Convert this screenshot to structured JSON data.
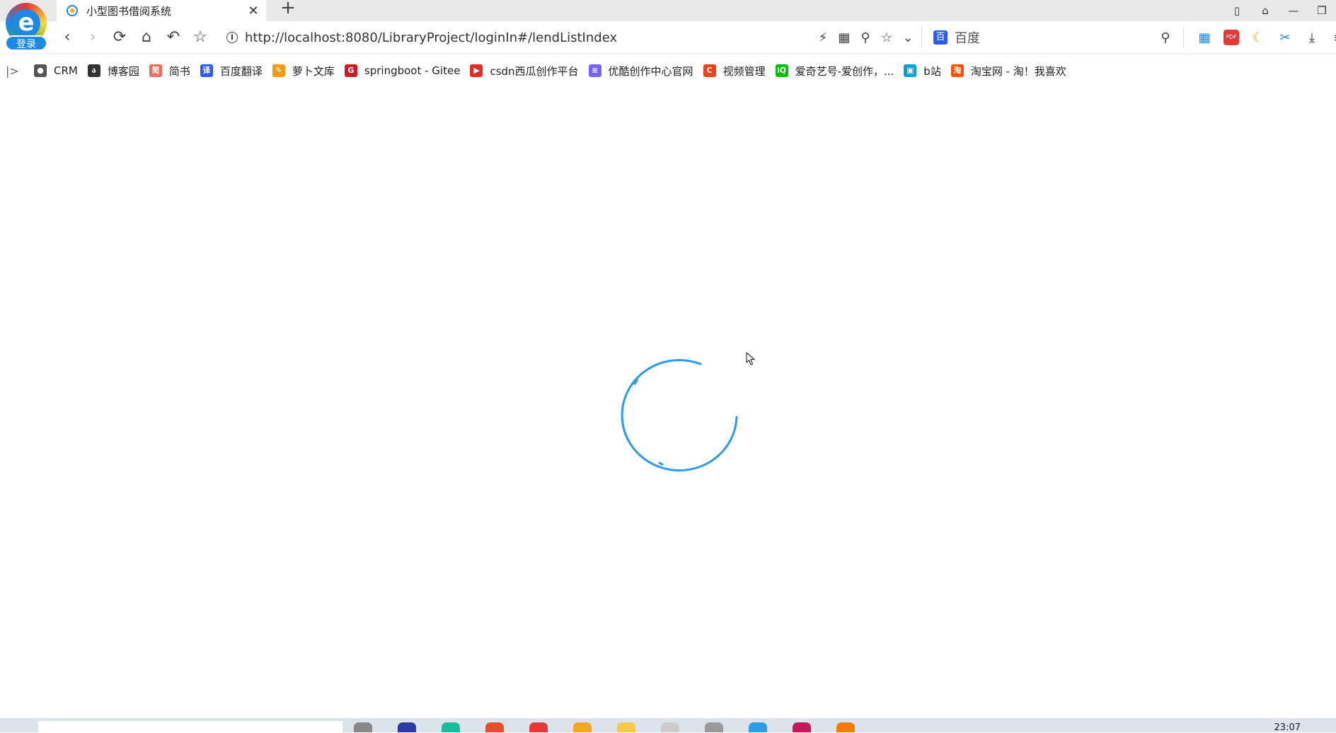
{
  "browser": {
    "logo_letter": "e",
    "login_label": "登录"
  },
  "tab": {
    "title": "小型图书借阅系统",
    "close_glyph": "✕"
  },
  "new_tab_glyph": "+",
  "window_controls": {
    "tile": "▯",
    "skin": "⌂",
    "minimize": "—",
    "restore": "❐"
  },
  "nav": {
    "back": "‹",
    "forward": "›",
    "reload": "⟳",
    "home": "⌂",
    "undo": "↶",
    "favorite": "☆"
  },
  "address": {
    "info_glyph": "i",
    "url": "http://localhost:8080/LibraryProject/loginIn#/lendListIndex"
  },
  "address_tools": [
    "⚡",
    "▦",
    "⚲",
    "☆",
    "⌄"
  ],
  "search": {
    "engine_glyph": "百",
    "placeholder": "百度",
    "search_glyph": "⚲"
  },
  "extensions": {
    "grid": "▦",
    "pdf": "PDF",
    "moon": "☾",
    "cut": "✂",
    "download": "⤓",
    "menu": "≡"
  },
  "bookmarks": {
    "toggle": "|>",
    "items": [
      {
        "label": "CRM",
        "icon": "globe-icon",
        "color": "#555555",
        "glyph": "●"
      },
      {
        "label": "博客园",
        "icon": "cnblogs-icon",
        "color": "#333333",
        "glyph": "ა"
      },
      {
        "label": "简书",
        "icon": "jianshu-icon",
        "color": "#ea6f5a",
        "glyph": "简"
      },
      {
        "label": "百度翻译",
        "icon": "translate-icon",
        "color": "#2b5de8",
        "glyph": "译"
      },
      {
        "label": "萝卜文库",
        "icon": "carrot-icon",
        "color": "#f39c12",
        "glyph": "✎"
      },
      {
        "label": "springboot - Gitee",
        "icon": "gitee-icon",
        "color": "#c71d23",
        "glyph": "G"
      },
      {
        "label": "csdn西瓜创作平台",
        "icon": "xigua-icon",
        "color": "#e02e24",
        "glyph": "▶"
      },
      {
        "label": "优酷创作中心官网",
        "icon": "youku-icon",
        "color": "#7b61ff",
        "glyph": "≋"
      },
      {
        "label": "视频管理",
        "icon": "csdn-icon",
        "color": "#e9441c",
        "glyph": "C"
      },
      {
        "label": "爱奇艺号-爱创作，...",
        "icon": "iqiyi-icon",
        "color": "#00be06",
        "glyph": "iQ"
      },
      {
        "label": "b站",
        "icon": "bilibili-icon",
        "color": "#00a1d6",
        "glyph": "▣"
      },
      {
        "label": "淘宝网 - 淘！我喜欢",
        "icon": "taobao-icon",
        "color": "#ff5000",
        "glyph": "淘"
      }
    ]
  },
  "colors": {
    "spinner": "#2d9be5",
    "accent": "#1e88e5"
  },
  "taskbar": {
    "clock": "23:07",
    "app_colors": [
      "#888888",
      "#2b3aa5",
      "#1abc9c",
      "#e94e2b",
      "#e53935",
      "#f5a623",
      "#f7c948",
      "#cccccc",
      "#999999",
      "#2d9be5",
      "#c2185b",
      "#f57c00"
    ]
  }
}
